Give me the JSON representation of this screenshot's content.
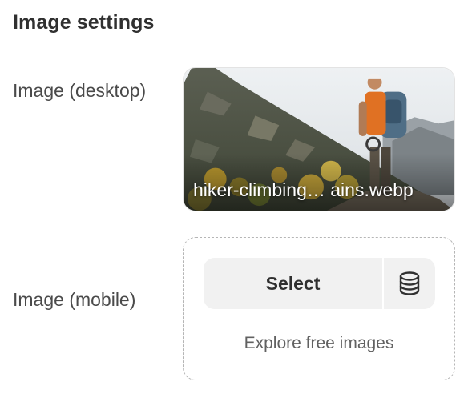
{
  "section": {
    "title": "Image settings"
  },
  "desktop_image": {
    "label": "Image (desktop)",
    "filename": "hiker-climbing… ains.webp"
  },
  "mobile_image": {
    "label": "Image (mobile)",
    "select_label": "Select",
    "library_icon": "database-icon",
    "explore_label": "Explore free images"
  }
}
